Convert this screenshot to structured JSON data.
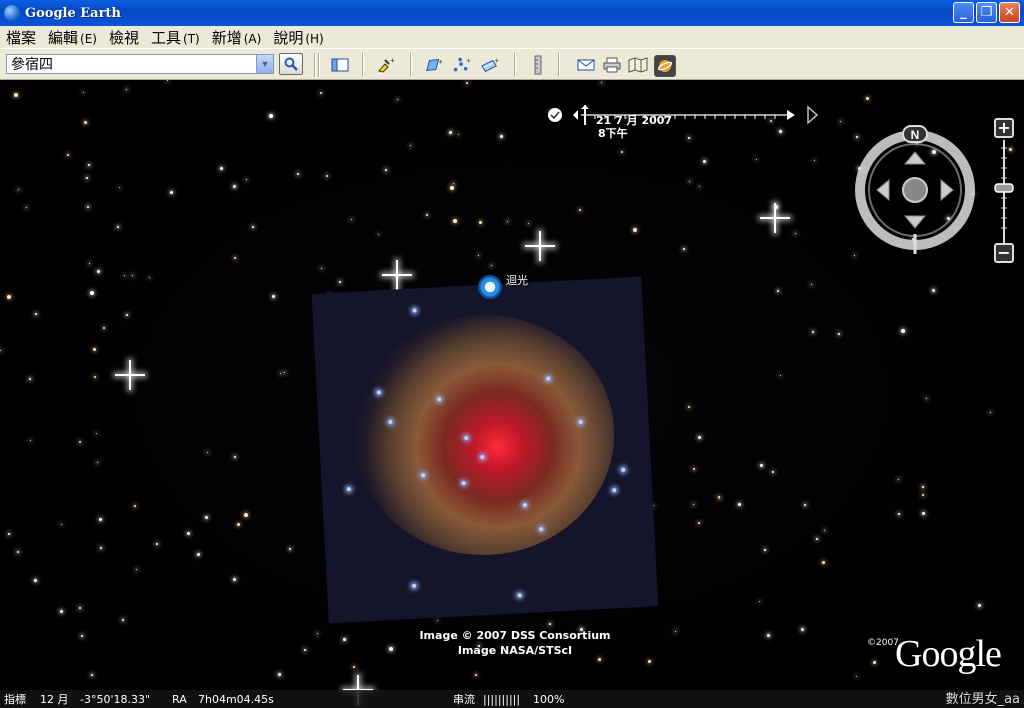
{
  "window": {
    "title": "Google Earth",
    "controls": {
      "minimize": "_",
      "maximize": "❐",
      "close": "✕"
    }
  },
  "menu": {
    "items": [
      {
        "label": "檔案",
        "accel": ""
      },
      {
        "label": "編輯",
        "accel": "(E)"
      },
      {
        "label": "檢視",
        "accel": ""
      },
      {
        "label": "工具",
        "accel": "(T)"
      },
      {
        "label": "新增",
        "accel": "(A)"
      },
      {
        "label": "說明",
        "accel": "(H)"
      }
    ]
  },
  "toolbar": {
    "search_value": "參宿四",
    "icons": [
      "sidebar-toggle-icon",
      "placemark-add-icon",
      "polygon-add-icon",
      "path-add-icon",
      "image-overlay-add-icon",
      "ruler-icon",
      "email-icon",
      "print-icon",
      "map-view-icon",
      "sky-mode-icon"
    ]
  },
  "map": {
    "placemark_label": "迴光",
    "credit_lines": [
      "Image © 2007 DSS Consortium",
      "Image NASA/STScI"
    ],
    "time": {
      "date": "21 7 月 2007",
      "time": "8下午"
    },
    "compass_north": "N",
    "zoom_in": "+",
    "zoom_out": "−",
    "logo_year": "©2007",
    "logo_text": "Google"
  },
  "status": {
    "pointer_label": "指標",
    "month": "12 月",
    "dec": "-3°50'18.33\"",
    "ra_label": "RA",
    "ra_value": "7h04m04.45s",
    "stream_label": "串流",
    "stream_bar": "||||||||||",
    "stream_percent": "100%"
  },
  "watermark": "數位男女_aa"
}
